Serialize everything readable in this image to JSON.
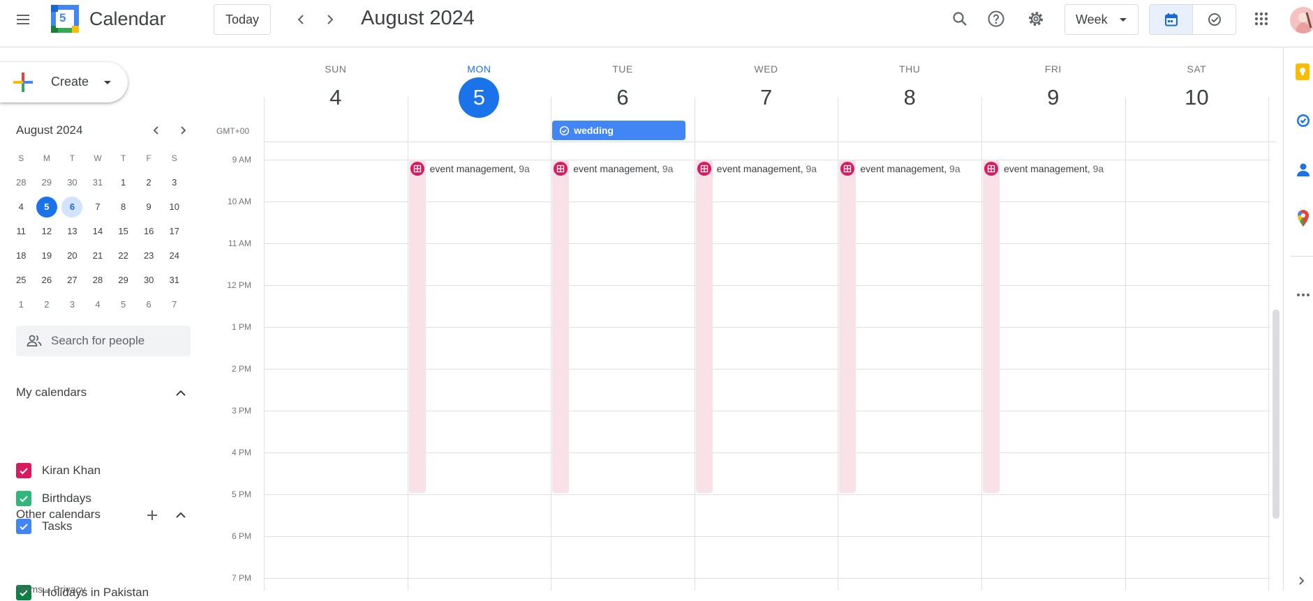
{
  "header": {
    "app_title": "Calendar",
    "logo_day": "5",
    "today_label": "Today",
    "month_title": "August 2024",
    "view_label": "Week"
  },
  "sidebar": {
    "create_label": "Create",
    "mini_calendar": {
      "title": "August 2024",
      "weekdays": [
        "S",
        "M",
        "T",
        "W",
        "T",
        "F",
        "S"
      ],
      "weeks": [
        [
          "28",
          "29",
          "30",
          "31",
          "1",
          "2",
          "3"
        ],
        [
          "4",
          "5",
          "6",
          "7",
          "8",
          "9",
          "10"
        ],
        [
          "11",
          "12",
          "13",
          "14",
          "15",
          "16",
          "17"
        ],
        [
          "18",
          "19",
          "20",
          "21",
          "22",
          "23",
          "24"
        ],
        [
          "25",
          "26",
          "27",
          "28",
          "29",
          "30",
          "31"
        ],
        [
          "1",
          "2",
          "3",
          "4",
          "5",
          "6",
          "7"
        ]
      ],
      "selected": "5",
      "highlighted": "6"
    },
    "search_people_placeholder": "Search for people",
    "my_calendars_title": "My calendars",
    "my_calendars": [
      {
        "name": "Kiran Khan",
        "color": "#d81b60"
      },
      {
        "name": "Birthdays",
        "color": "#33b679"
      },
      {
        "name": "Tasks",
        "color": "#4285f4"
      }
    ],
    "other_calendars_title": "Other calendars",
    "other_calendars": [
      {
        "name": "Holidays in Pakistan",
        "color": "#0b8043"
      }
    ],
    "footer": "Terms – Privacy"
  },
  "week": {
    "timezone": "GMT+00",
    "days": [
      {
        "name": "SUN",
        "date": "4"
      },
      {
        "name": "MON",
        "date": "5",
        "current": true
      },
      {
        "name": "TUE",
        "date": "6"
      },
      {
        "name": "WED",
        "date": "7"
      },
      {
        "name": "THU",
        "date": "8"
      },
      {
        "name": "FRI",
        "date": "9"
      },
      {
        "name": "SAT",
        "date": "10"
      }
    ],
    "times": [
      "9 AM",
      "10 AM",
      "11 AM",
      "12 PM",
      "1 PM",
      "2 PM",
      "3 PM",
      "4 PM",
      "5 PM",
      "6 PM",
      "7 PM"
    ],
    "all_day_event": {
      "title": "wedding",
      "day_index": 2,
      "color": "#4285f4"
    },
    "events": [
      {
        "title": "event management,",
        "time": "9a",
        "day_index": 1,
        "color": "#d81b60"
      },
      {
        "title": "event management,",
        "time": "9a",
        "day_index": 2,
        "color": "#d81b60"
      },
      {
        "title": "event management,",
        "time": "9a",
        "day_index": 3,
        "color": "#d81b60"
      },
      {
        "title": "event management,",
        "time": "9a",
        "day_index": 4,
        "color": "#d81b60"
      },
      {
        "title": "event management,",
        "time": "9a",
        "day_index": 5,
        "color": "#d81b60"
      }
    ]
  },
  "colors": {
    "accent": "#1a73e8",
    "event_bg": "#f8e1e7"
  }
}
